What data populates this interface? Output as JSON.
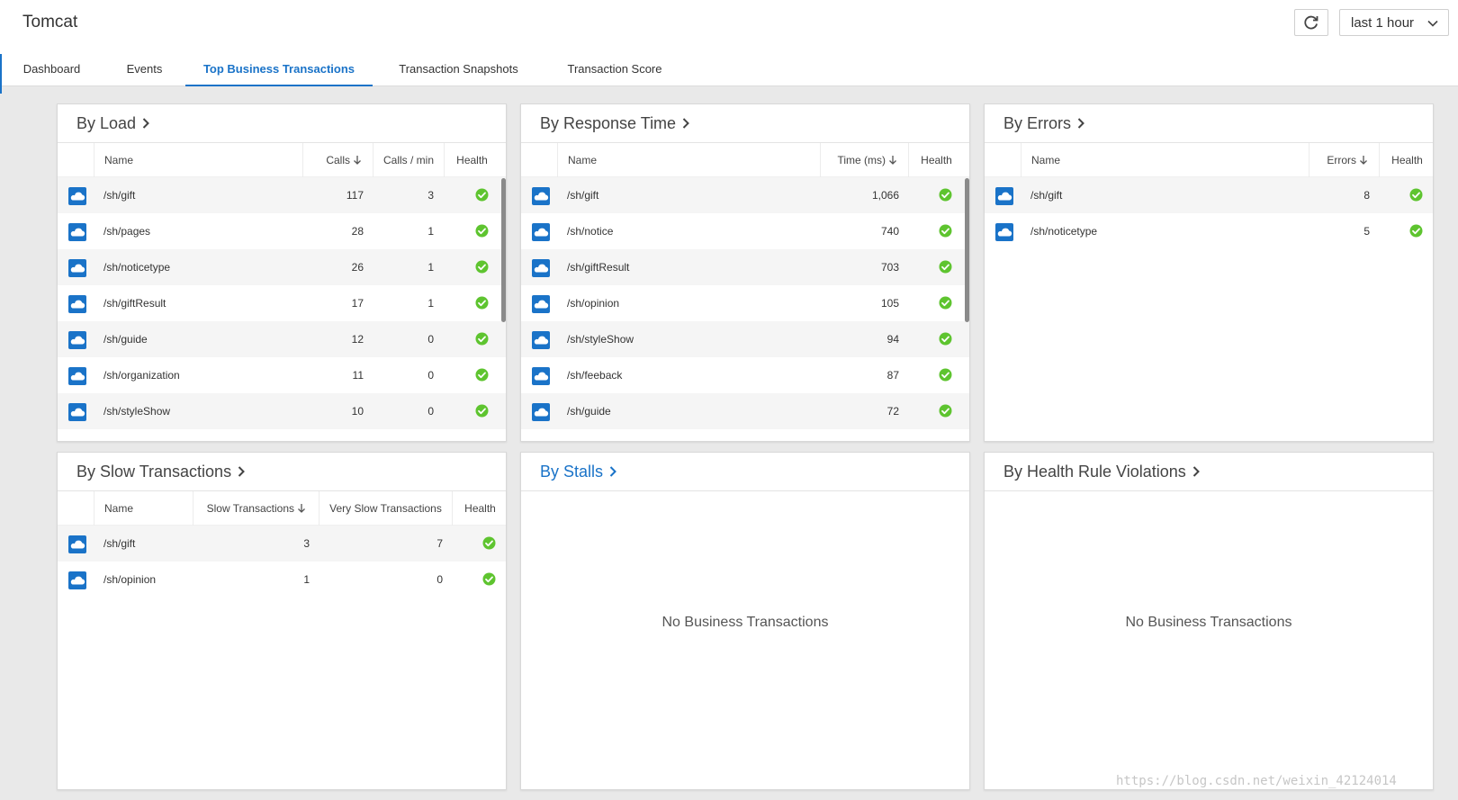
{
  "app": {
    "title": "Tomcat",
    "time_range": "last 1 hour"
  },
  "tabs": [
    {
      "label": "Dashboard",
      "active": false
    },
    {
      "label": "Events",
      "active": false
    },
    {
      "label": "Top Business Transactions",
      "active": true
    },
    {
      "label": "Transaction Snapshots",
      "active": false
    },
    {
      "label": "Transaction Score",
      "active": false
    }
  ],
  "colors": {
    "accent": "#1a73c8",
    "health_ok": "#5ec42f",
    "icon_bg": "#1a73c8"
  },
  "by_load": {
    "title": "By Load",
    "columns": {
      "name": "Name",
      "calls": "Calls",
      "calls_min": "Calls / min",
      "health": "Health"
    },
    "rows": [
      {
        "name": "/sh/gift",
        "calls": "117",
        "calls_min": "3"
      },
      {
        "name": "/sh/pages",
        "calls": "28",
        "calls_min": "1"
      },
      {
        "name": "/sh/noticetype",
        "calls": "26",
        "calls_min": "1"
      },
      {
        "name": "/sh/giftResult",
        "calls": "17",
        "calls_min": "1"
      },
      {
        "name": "/sh/guide",
        "calls": "12",
        "calls_min": "0"
      },
      {
        "name": "/sh/organization",
        "calls": "11",
        "calls_min": "0"
      },
      {
        "name": "/sh/styleShow",
        "calls": "10",
        "calls_min": "0"
      }
    ]
  },
  "by_response_time": {
    "title": "By Response Time",
    "columns": {
      "name": "Name",
      "time": "Time (ms)",
      "health": "Health"
    },
    "rows": [
      {
        "name": "/sh/gift",
        "time": "1,066"
      },
      {
        "name": "/sh/notice",
        "time": "740"
      },
      {
        "name": "/sh/giftResult",
        "time": "703"
      },
      {
        "name": "/sh/opinion",
        "time": "105"
      },
      {
        "name": "/sh/styleShow",
        "time": "94"
      },
      {
        "name": "/sh/feeback",
        "time": "87"
      },
      {
        "name": "/sh/guide",
        "time": "72"
      }
    ]
  },
  "by_errors": {
    "title": "By Errors",
    "columns": {
      "name": "Name",
      "errors": "Errors",
      "health": "Health"
    },
    "rows": [
      {
        "name": "/sh/gift",
        "errors": "8"
      },
      {
        "name": "/sh/noticetype",
        "errors": "5"
      }
    ]
  },
  "by_slow": {
    "title": "By Slow Transactions",
    "columns": {
      "name": "Name",
      "slow": "Slow Transactions",
      "very_slow": "Very Slow Transactions",
      "health": "Health"
    },
    "rows": [
      {
        "name": "/sh/gift",
        "slow": "3",
        "very_slow": "7"
      },
      {
        "name": "/sh/opinion",
        "slow": "1",
        "very_slow": "0"
      }
    ]
  },
  "by_stalls": {
    "title": "By Stalls",
    "empty": "No Business Transactions"
  },
  "by_health": {
    "title": "By Health Rule Violations",
    "empty": "No Business Transactions"
  },
  "watermark": "https://blog.csdn.net/weixin_42124014"
}
